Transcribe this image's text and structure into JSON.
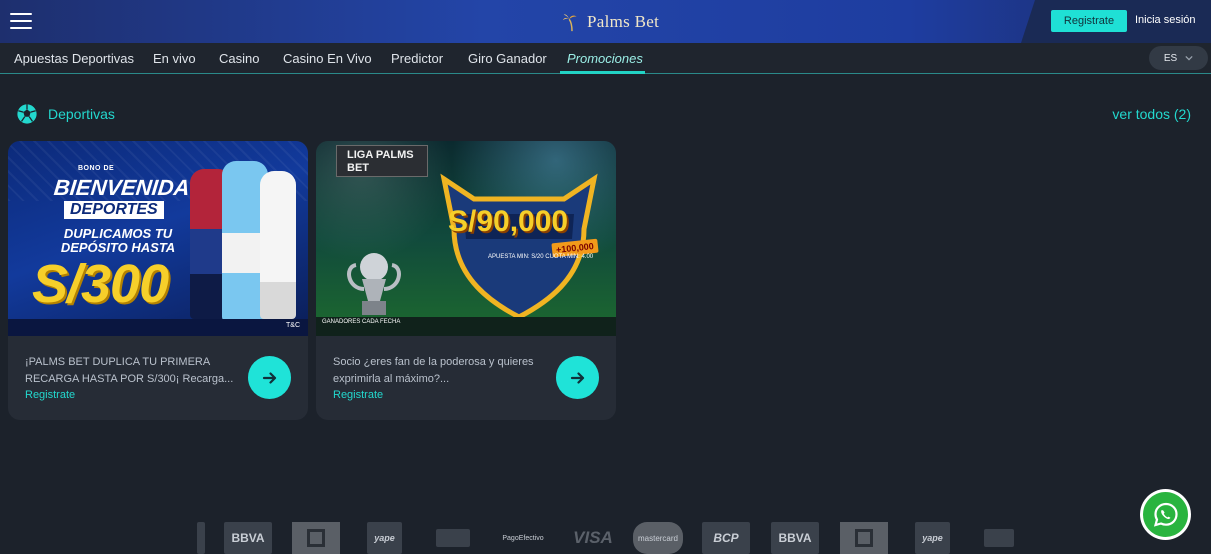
{
  "header": {
    "logo_text": "Palms Bet",
    "register_label": "Registrate",
    "login_label": "Inicia sesión"
  },
  "nav": {
    "items": [
      {
        "label": "Apuestas Deportivas"
      },
      {
        "label": "En vivo"
      },
      {
        "label": "Casino"
      },
      {
        "label": "Casino En Vivo"
      },
      {
        "label": "Predictor"
      },
      {
        "label": "Giro Ganador"
      },
      {
        "label": "Promociones",
        "active": true
      }
    ],
    "language": "ES"
  },
  "section": {
    "title": "Deportivas",
    "see_all": "ver todos (2)"
  },
  "cards": [
    {
      "banner": {
        "small": "BONO DE",
        "big": "BIENVENIDA",
        "tag": "DEPORTES",
        "line": "DUPLICAMOS TU DEPÓSITO HASTA",
        "amount": "S/300",
        "tc": "T&C"
      },
      "description": "¡PALMS BET DUPLICA TU PRIMERA RECARGA HASTA POR S/300¡ Recarga...",
      "cta": "Registrate"
    },
    {
      "banner": {
        "liga": "LIGA PALMS BET",
        "amount": "S/90,000",
        "bonus": "+100,000",
        "apuesta": "APUESTA MIN: S/20 CUOTA MIN: 4.00",
        "strip": "GANADORES CADA FECHA"
      },
      "description": "Socio ¿eres fan de la poderosa y quieres exprimirla al máximo?...",
      "cta": "Registrate"
    }
  ],
  "payments": [
    "BBVA",
    "yape",
    "PagoEfectivo",
    "VISA",
    "mastercard",
    "BCP",
    "BBVA",
    "yape"
  ],
  "colors": {
    "accent": "#23d8ce",
    "header": "#1e3a8a",
    "background": "#1c222b",
    "card": "#262c36"
  }
}
